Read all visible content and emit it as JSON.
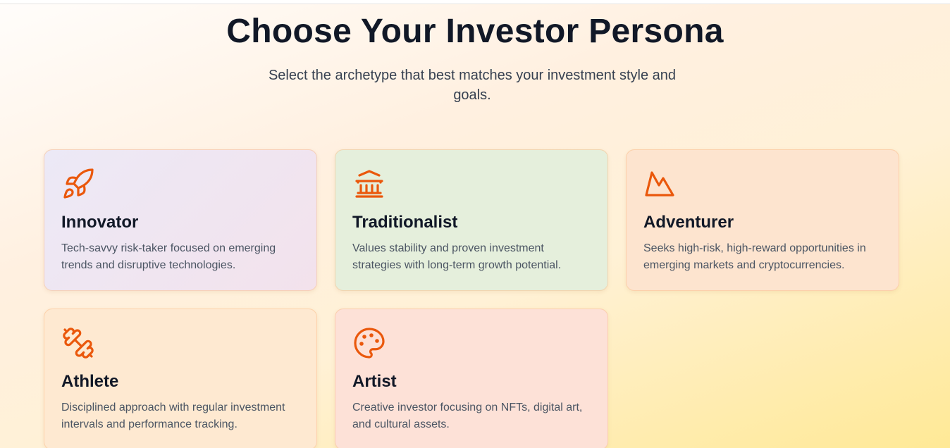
{
  "header": {
    "title": "Choose Your Investor Persona",
    "subtitle": "Select the archetype that best matches your investment style and goals."
  },
  "theme": {
    "accent": "#ea580c",
    "heading": "#111827",
    "body_text": "#4b5563"
  },
  "personas": [
    {
      "name": "Innovator",
      "icon": "rocket-icon",
      "description": "Tech-savvy risk-taker focused on emerging trends and disruptive technologies."
    },
    {
      "name": "Traditionalist",
      "icon": "bank-icon",
      "description": "Values stability and proven investment strategies with long-term growth potential."
    },
    {
      "name": "Adventurer",
      "icon": "mountain-icon",
      "description": "Seeks high-risk, high-reward opportunities in emerging markets and cryptocurrencies."
    },
    {
      "name": "Athlete",
      "icon": "dumbbell-icon",
      "description": "Disciplined approach with regular investment intervals and performance tracking."
    },
    {
      "name": "Artist",
      "icon": "palette-icon",
      "description": "Creative investor focusing on NFTs, digital art, and cultural assets."
    }
  ]
}
